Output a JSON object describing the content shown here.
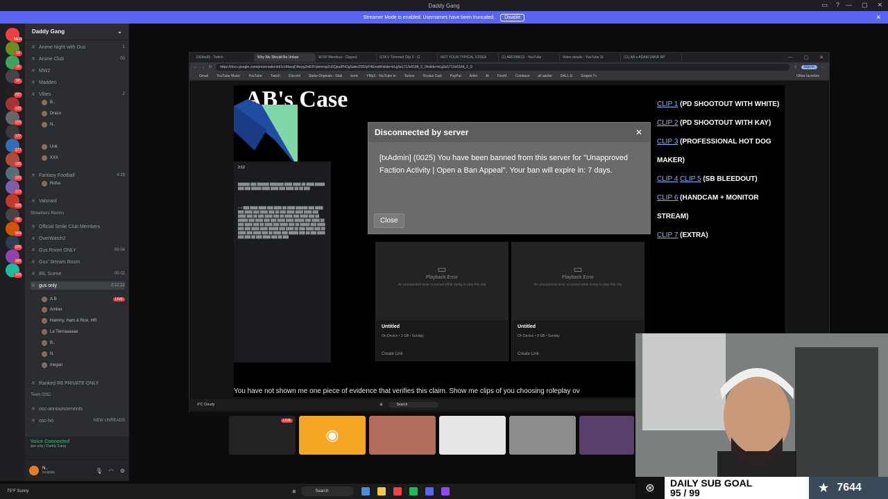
{
  "titlebar": {
    "title": "Daddy Gang"
  },
  "streamer_banner": {
    "text": "Streamer Mode is enabled. Usernames have been truncated.",
    "button": "Disable"
  },
  "rail_badges": [
    "NEW",
    "18",
    "36",
    "58",
    "HO",
    "133",
    "128",
    "177",
    "277",
    "193",
    "183",
    "113",
    "288",
    "45",
    "984",
    "226",
    "399",
    "168"
  ],
  "guild": {
    "name": "Daddy Gang"
  },
  "channels": [
    {
      "name": "Anime Night with Gus",
      "right": "1"
    },
    {
      "name": "Anime Club",
      "right": "00"
    },
    {
      "name": "MW2",
      "right": ""
    },
    {
      "name": "Madden",
      "right": ""
    },
    {
      "name": "Vibes",
      "right": "2"
    },
    {
      "name": "Fantasy Football",
      "right": "4:19"
    },
    {
      "name": "Valorant",
      "right": ""
    },
    {
      "name": "Official Smile Club Members",
      "right": ""
    },
    {
      "name": "OverWatch2",
      "right": ""
    },
    {
      "name": "Gus Room ONLY",
      "right": "00 04"
    },
    {
      "name": "Gus' Stream Room",
      "right": ""
    },
    {
      "name": "IRL Scene",
      "right": "00 02"
    },
    {
      "name": "gus only",
      "right": "2:12:22"
    },
    {
      "name": "Ranked R6 PRIVATE ONLY",
      "right": ""
    },
    {
      "name": "osc-announcements",
      "right": ""
    },
    {
      "name": "osc-ho",
      "right": "NEW UNREADS"
    }
  ],
  "voice_users": [
    "B..",
    "Draco",
    "N..",
    "Unk",
    "XXX",
    "Rofus",
    "A.B",
    "Amber",
    "Hammy, Ham & Rick, HR",
    "La Tierraaaaaa",
    "B..",
    "N.",
    "megan"
  ],
  "categories": [
    "Streamers Rooms",
    "Team OSC"
  ],
  "voice_panel": {
    "status": "Voice Connected",
    "sub": "gus only / Daddy Gang"
  },
  "user_panel": {
    "name": "N..",
    "status": "Invisible"
  },
  "browser": {
    "tabs": [
      "DGthe99 - Twitch",
      "Why We Should Be Unban",
      "W RP Bleedout - Clipped",
      "GTA V Trimmed Clip 2 - Cl",
      "NOT YOUR TYPICAL STREA",
      "(1) ARFRM613 - YouTube",
      "Video details - YouTube St",
      "(11) AB x ADAM SNNR RP"
    ],
    "url": "https://docs.google.com/presentation/d/1roMacqOAeyg2mE9VpbmmpZo5QpuIPhOgSabo2S53yF4E/edit#slide=id.g3a1712e6184_0_0#slide=id.g3a1712e6184_0_0",
    "signin": "Sign in",
    "bookmarks": [
      "Gmail",
      "YouTube Music",
      "YouTube",
      "Twitch",
      "Discord",
      "Stake Originals - Stak",
      "bonk",
      "YMp3 - YouTube to",
      "Tarkov",
      "Oculus Cast",
      "PayPal",
      "Artist",
      "AI",
      "FiveM",
      "Coinbase",
      "all adobe",
      "DALL-E",
      "Soapm.Tv"
    ],
    "other_bookmarks": "Other favorites"
  },
  "slide": {
    "title": "AB's Case",
    "clips": [
      {
        "links": [
          "CLIP 1"
        ],
        "desc": "(PD SHOOTOUT WITH WHITE)"
      },
      {
        "links": [
          "CLIP 2"
        ],
        "desc": "(PD SHOOTOUT WITH KAY)"
      },
      {
        "links": [
          "CLIP 3"
        ],
        "desc": "(PROFESSIONAL HOT DOG MAKER)"
      },
      {
        "links": [
          "CLIP 4",
          "CLIP 5"
        ],
        "desc": "(SB BLEEDOUT)"
      },
      {
        "links": [
          "CLIP 6"
        ],
        "desc": "(HANDCAM + MONITOR STREAM)"
      },
      {
        "links": [
          "CLIP 7"
        ],
        "desc": "(EXTRA)"
      }
    ],
    "videos": [
      {
        "error": "Playback Error",
        "error_sub": "An unexpected error occurred while trying to play this clip",
        "title": "Untitled",
        "meta": "On Device • 1 GB • Sunday",
        "link": "Create Link"
      },
      {
        "error": "Playback Error",
        "error_sub": "An unexpected error occurred while trying to play this clip",
        "title": "Untitled",
        "meta": "On Device • 9 GB • Sunday",
        "link": "Create Link"
      }
    ],
    "caption": "You have not shown me one piece of evidence that verifies this claim. Show me clips of you choosing roleplay ov"
  },
  "modal": {
    "title": "Disconnected by server",
    "message": "[txAdmin] (0025) You have been banned from this server for \"Unapproved Faction Activity | Open a Ban Appeal\". Your ban will expire in: 7 days.",
    "close": "Close"
  },
  "inner_taskbar": {
    "weather": "4°C Cloudy",
    "search": "Search"
  },
  "host_taskbar": {
    "weather": "75°F Sunny",
    "search": "Search"
  },
  "sub_goal": {
    "label": "DAILY SUB GOAL",
    "progress": "95 / 99",
    "count": "7644"
  },
  "colors": {
    "discord_blurple": "#5865f2",
    "live_red": "#ed4245",
    "voice_green": "#23a55a",
    "link_blue": "#8ab4f8"
  }
}
